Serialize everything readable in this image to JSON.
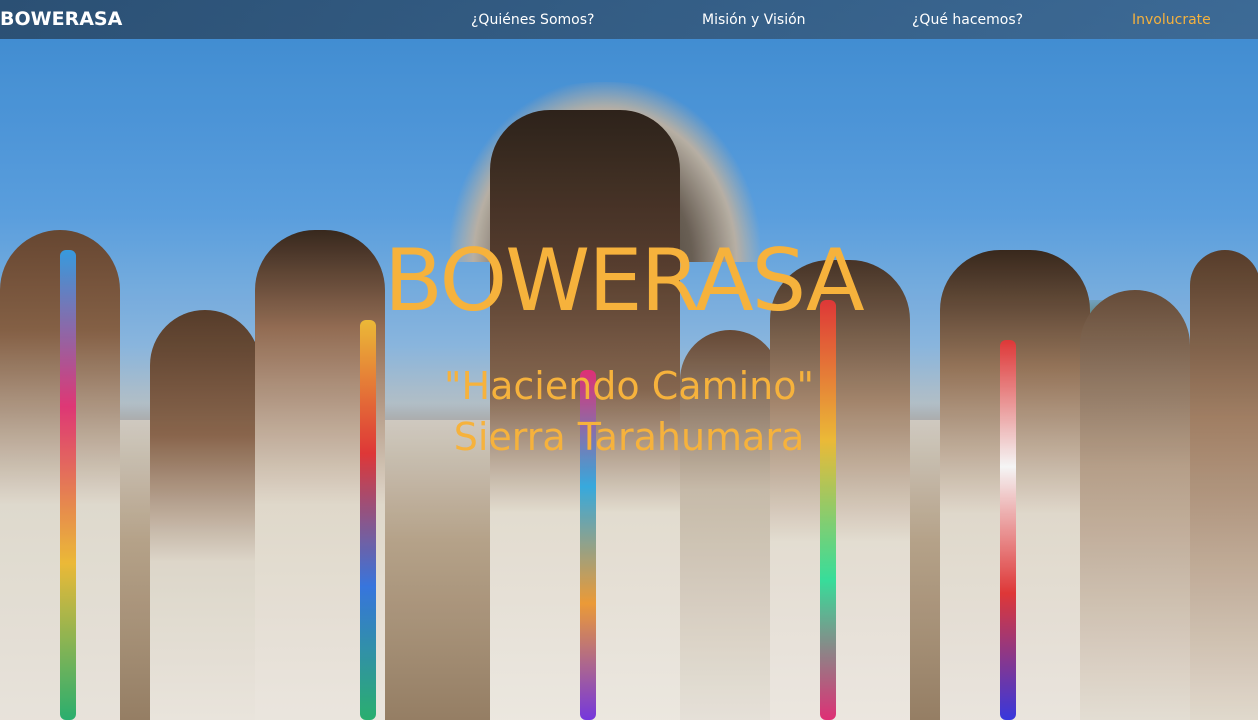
{
  "brand": {
    "logo_text": "BOWERASA"
  },
  "nav": {
    "items": [
      {
        "label": "¿Quiénes Somos?"
      },
      {
        "label": "Misión y Visión"
      },
      {
        "label": "¿Qué hacemos?"
      },
      {
        "label": "Involucrate"
      }
    ],
    "active_color": "#f5b13d"
  },
  "hero": {
    "logo_text": "BOWERASA",
    "tagline_line1": "\"Haciendo Camino\"",
    "tagline_line2": "Sierra Tarahumara",
    "accent_color": "#f6b23c"
  }
}
